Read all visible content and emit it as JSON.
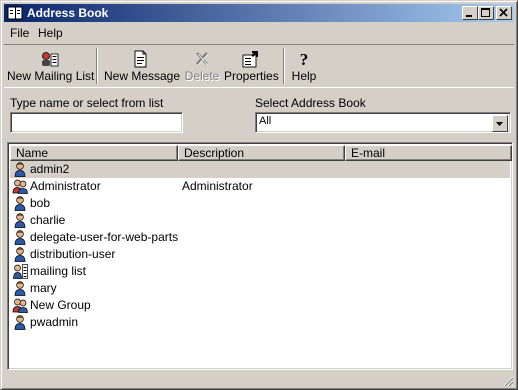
{
  "window": {
    "title": "Address Book"
  },
  "menu": {
    "items": [
      "File",
      "Help"
    ]
  },
  "toolbar": {
    "new_mailing_list": "New Mailing List",
    "new_message": "New Message",
    "delete": "Delete",
    "properties": "Properties",
    "help": "Help"
  },
  "search": {
    "name_label": "Type name or select from list",
    "name_value": "",
    "book_label": "Select Address Book",
    "book_value": "All"
  },
  "list": {
    "columns": [
      "Name",
      "Description",
      "E-mail"
    ],
    "rows": [
      {
        "name": "admin2",
        "description": "",
        "email": "",
        "icon": "user-icon"
      },
      {
        "name": "Administrator",
        "description": "Administrator",
        "email": "",
        "icon": "group-icon"
      },
      {
        "name": "bob",
        "description": "",
        "email": "",
        "icon": "user-icon"
      },
      {
        "name": "charlie",
        "description": "",
        "email": "",
        "icon": "user-icon"
      },
      {
        "name": "delegate-user-for-web-parts",
        "description": "",
        "email": "",
        "icon": "user-icon"
      },
      {
        "name": "distribution-user",
        "description": "",
        "email": "",
        "icon": "user-icon"
      },
      {
        "name": "mailing list",
        "description": "",
        "email": "",
        "icon": "mailing-list-icon"
      },
      {
        "name": "mary",
        "description": "",
        "email": "",
        "icon": "user-icon"
      },
      {
        "name": "New Group",
        "description": "",
        "email": "",
        "icon": "group-icon"
      },
      {
        "name": "pwadmin",
        "description": "",
        "email": "",
        "icon": "user-icon"
      }
    ]
  }
}
